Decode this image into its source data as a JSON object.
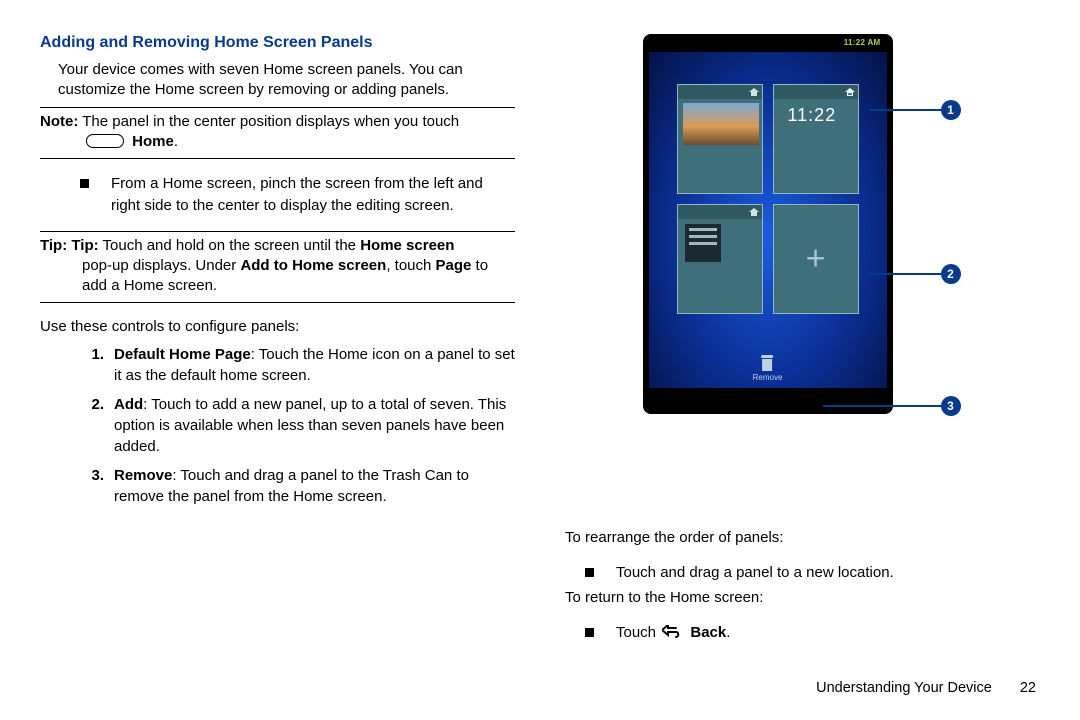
{
  "header": {
    "title": "Adding and Removing Home Screen Panels"
  },
  "intro": "Your device comes with seven Home screen panels. You can customize the Home screen by removing or adding panels.",
  "note": {
    "label": "Note:",
    "text_before_icon": "The panel in the center position displays when you touch",
    "home_word": "Home",
    "text_after": "."
  },
  "pinch_bullet": "From a Home screen, pinch the screen from the left and right side to the center to display the editing screen.",
  "tip": {
    "label": "Tip: Tip:",
    "part1": "Touch and hold on the screen until the ",
    "bold1": "Home screen",
    "part2": " pop-up displays. Under ",
    "bold2": "Add to Home screen",
    "part3": ", touch ",
    "bold3": "Page",
    "part4": " to add a Home screen."
  },
  "controls_intro": "Use these controls to configure panels:",
  "controls": [
    {
      "num": "1.",
      "title": "Default Home Page",
      "text": ": Touch the Home icon on a panel to set it as the default home screen."
    },
    {
      "num": "2.",
      "title": "Add",
      "text": ": Touch to add a new panel, up to a total of seven. This option is available when less than seven panels have been added."
    },
    {
      "num": "3.",
      "title": "Remove",
      "text": ": Touch and drag a panel to the Trash Can to remove the panel from the Home screen."
    }
  ],
  "right": {
    "rearrange_intro": "To rearrange the order of panels:",
    "rearrange_bullet": "Touch and drag a panel to a new location.",
    "return_intro": "To return to the Home screen:",
    "return_touch": "Touch ",
    "return_back": "Back",
    "return_after": "."
  },
  "illustration": {
    "status_time": "11:22 AM",
    "clock_text": "11:22",
    "remove_label": "Remove",
    "callouts": {
      "1": "1",
      "2": "2",
      "3": "3"
    }
  },
  "footer": {
    "section": "Understanding Your Device",
    "page": "22"
  }
}
